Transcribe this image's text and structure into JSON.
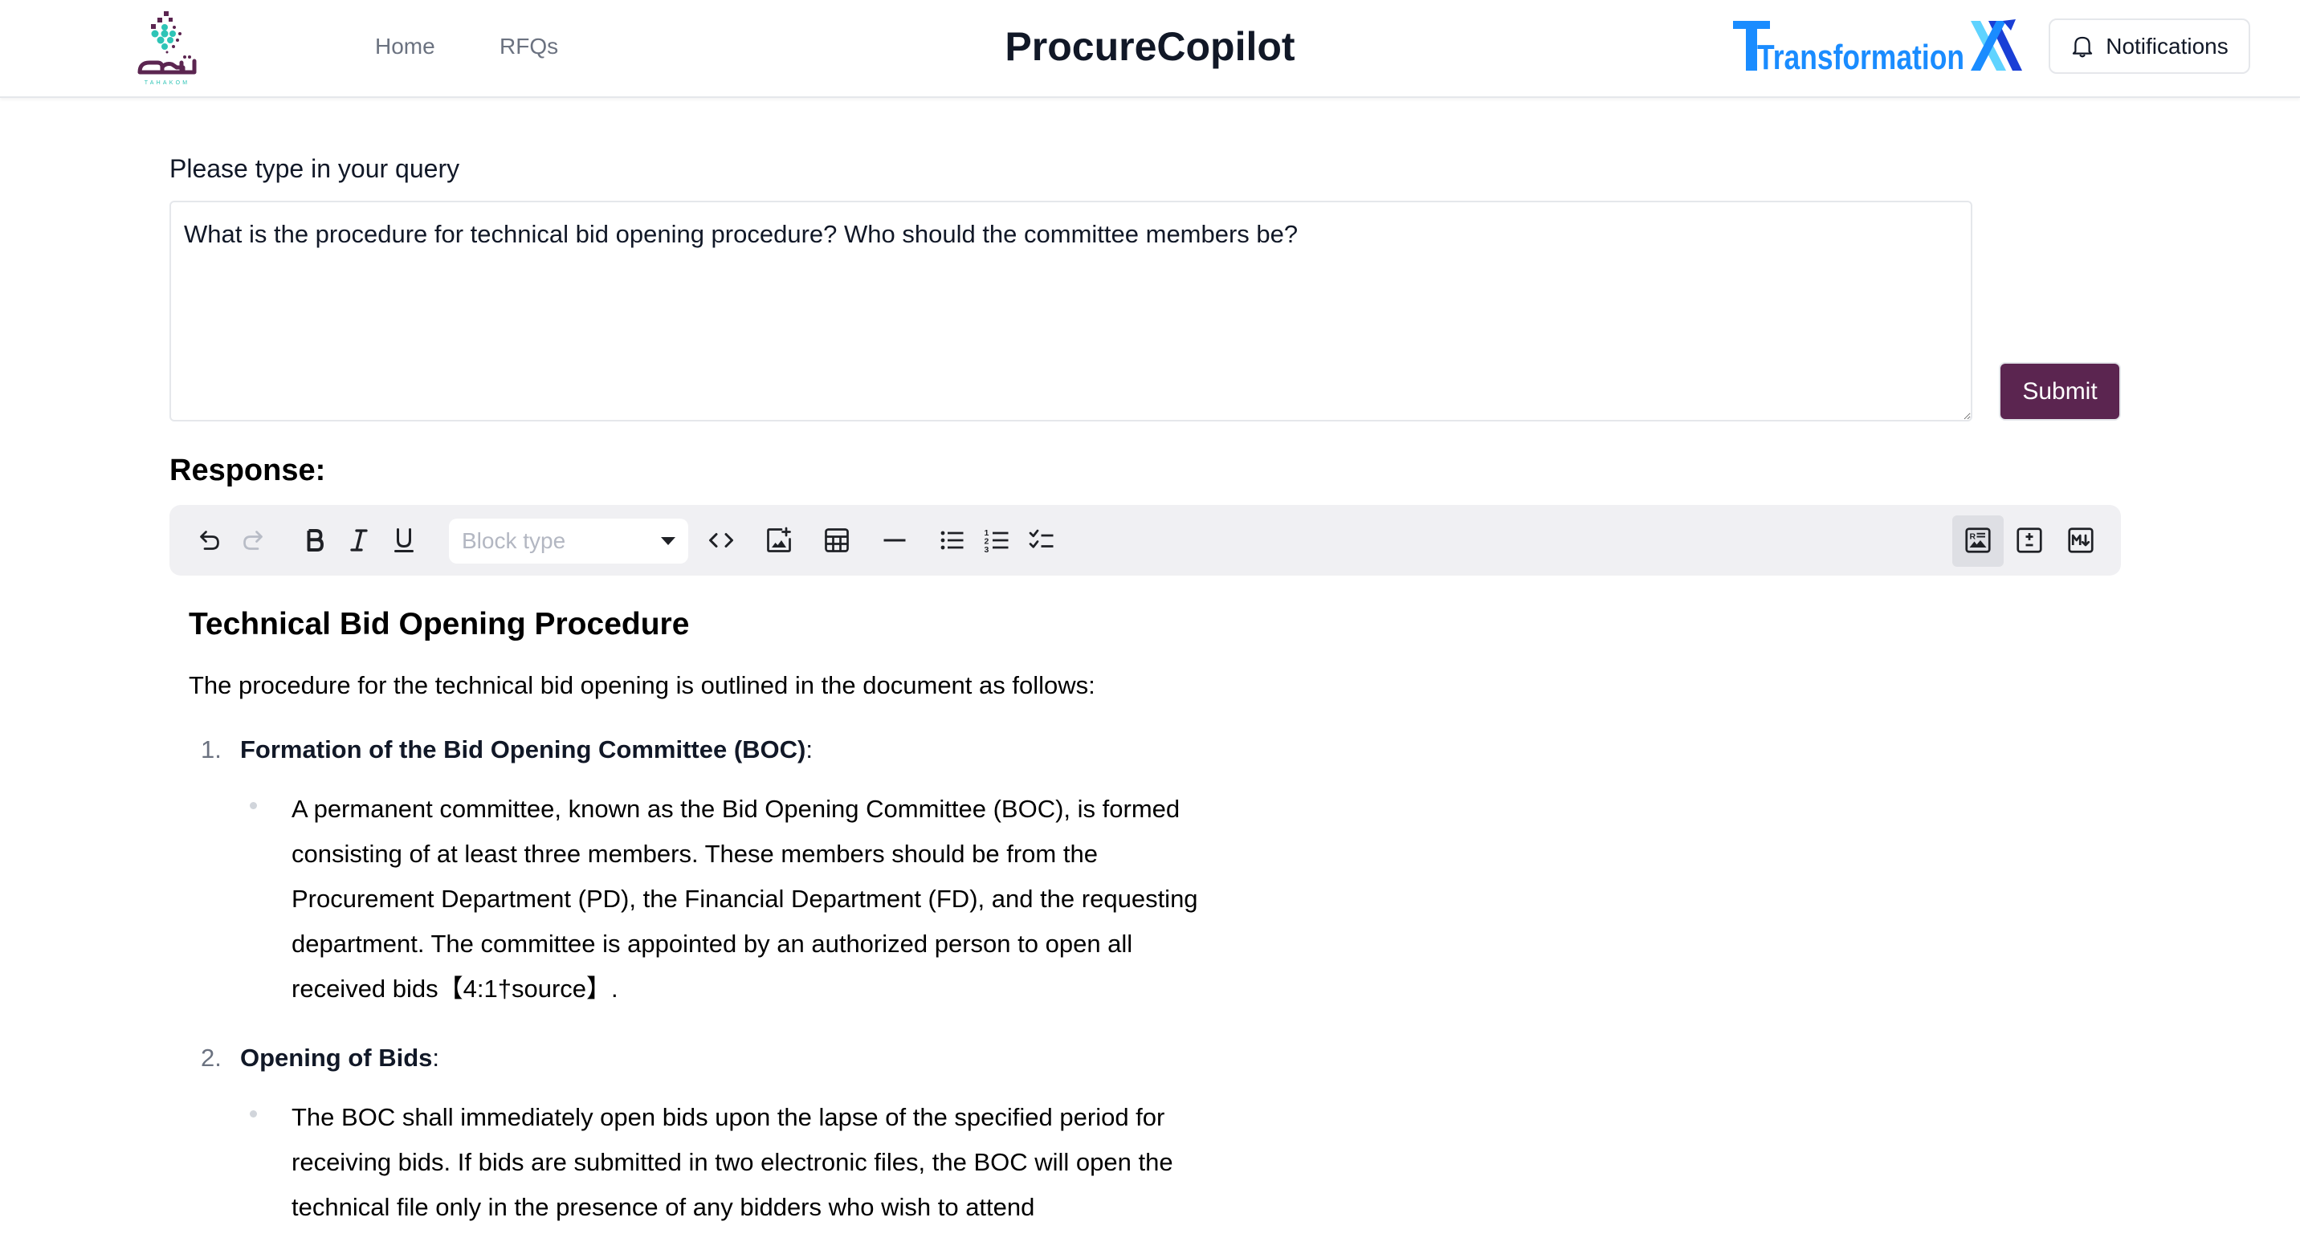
{
  "header": {
    "logo_alt": "Tahakom",
    "logo_caption": "TAHAKOM",
    "nav": [
      {
        "label": "Home"
      },
      {
        "label": "RFQs"
      }
    ],
    "app_title": "ProcureCopilot",
    "partner_logo_text": "Transformation",
    "notifications_label": "Notifications"
  },
  "query": {
    "label": "Please type in your query",
    "value": "What is the procedure for technical bid opening procedure? Who should the committee members be?",
    "submit_label": "Submit"
  },
  "response": {
    "heading": "Response:",
    "toolbar": {
      "block_type_placeholder": "Block type",
      "icons": [
        "undo-icon",
        "redo-icon",
        "bold-icon",
        "italic-icon",
        "underline-icon",
        "code-icon",
        "insert-image-icon",
        "table-icon",
        "horizontal-rule-icon",
        "bullet-list-icon",
        "numbered-list-icon",
        "checklist-icon",
        "rich-text-view-icon",
        "diff-view-icon",
        "markdown-view-icon"
      ]
    },
    "document": {
      "title": "Technical Bid Opening Procedure",
      "intro": "The procedure for the technical bid opening is outlined in the document as follows:",
      "steps": [
        {
          "number": "1.",
          "title": "Formation of the Bid Opening Committee (BOC)",
          "suffix": ":",
          "bullets": [
            "A permanent committee, known as the Bid Opening Committee (BOC), is formed consisting of at least three members. These members should be from the Procurement Department (PD), the Financial Department (FD), and the requesting department. The committee is appointed by an authorized person to open all received bids【4:1†source】."
          ]
        },
        {
          "number": "2.",
          "title": "Opening of Bids",
          "suffix": ":",
          "bullets": [
            "The BOC shall immediately open bids upon the lapse of the specified period for receiving bids. If bids are submitted in two electronic files, the BOC will open the technical file only in the presence of any bidders who wish to attend"
          ]
        }
      ]
    }
  },
  "colors": {
    "brand_primary": "#5b2550",
    "brand_teal": "#2ec4b6",
    "partner_blue": "#1a8cff",
    "text_dark": "#111827",
    "nav_gray": "#6b7280",
    "toolbar_bg": "#f0f0f3"
  }
}
